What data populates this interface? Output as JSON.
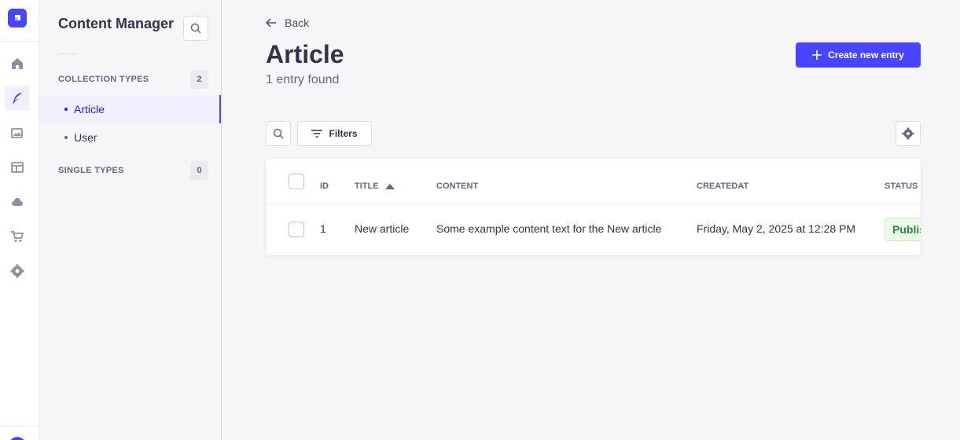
{
  "colors": {
    "accent": "#4945ff",
    "accent_light": "#f0f0ff",
    "success_text": "#328048",
    "success_bg": "#eafbe7"
  },
  "rail": {
    "icons": [
      "strapi-logo-icon",
      "home-icon",
      "feather-icon",
      "images-icon",
      "layout-icon",
      "cloud-icon",
      "cart-icon",
      "gear-icon"
    ]
  },
  "subnav": {
    "title": "Content Manager",
    "collection_types": {
      "label": "COLLECTION TYPES",
      "count": "2",
      "items": [
        {
          "label": "Article",
          "active": true
        },
        {
          "label": "User",
          "active": false
        }
      ]
    },
    "single_types": {
      "label": "SINGLE TYPES",
      "count": "0"
    }
  },
  "header": {
    "back_label": "Back",
    "title": "Article",
    "subtitle": "1 entry found",
    "create_label": "Create new entry"
  },
  "toolbar": {
    "filters_label": "Filters"
  },
  "table": {
    "columns": [
      "ID",
      "TITLE",
      "CONTENT",
      "CREATEDAT",
      "STATUS"
    ],
    "sorted_column": "TITLE",
    "sort_direction": "ascending",
    "rows": [
      {
        "id": "1",
        "title": "New article",
        "content": "Some example content text for the New article",
        "createdat": "Friday, May 2, 2025 at 12:28 PM",
        "status": "Published"
      }
    ]
  }
}
